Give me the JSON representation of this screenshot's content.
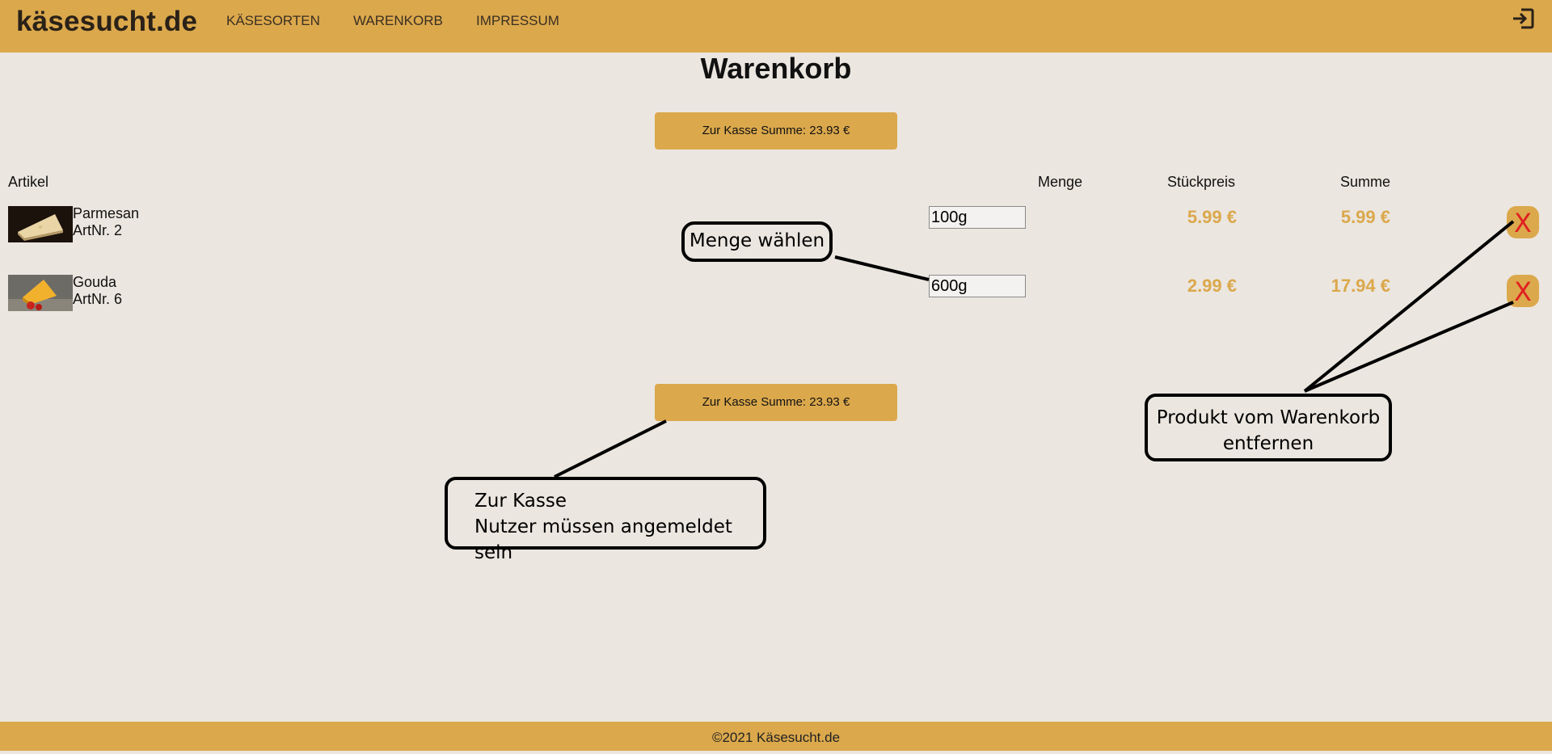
{
  "nav": {
    "brand": "käsesucht.de",
    "links": [
      "KÄSESORTEN",
      "WARENKORB",
      "IMPRESSUM"
    ]
  },
  "page_title": "Warenkorb",
  "checkout": {
    "top_label": "Zur Kasse Summe: 23.93 €",
    "bottom_label": "Zur Kasse Summe: 23.93 €"
  },
  "table": {
    "headers": [
      "Artikel",
      "Menge",
      "Stückpreis",
      "Summe"
    ],
    "rows": [
      {
        "name": "Parmesan",
        "art": "ArtNr. 2",
        "qty": "100g",
        "unit_price": "5.99 €",
        "sum": "5.99 €",
        "remove": "X"
      },
      {
        "name": "Gouda",
        "art": "ArtNr. 6",
        "qty": "600g",
        "unit_price": "2.99 €",
        "sum": "17.94 €",
        "remove": "X"
      }
    ]
  },
  "annotations": {
    "menge": "Menge wählen",
    "remove_line1": "Produkt vom Warenkorb",
    "remove_line2": "entfernen",
    "kasse_line1": "Zur Kasse",
    "kasse_line2": "Nutzer müssen angemeldet sein"
  },
  "footer": "©2021 Käsesucht.de",
  "icons": [
    "login-icon",
    "close-icon"
  ],
  "colors": {
    "accent": "#dba84c",
    "background": "#ebe6df",
    "remove": "#e02020"
  }
}
